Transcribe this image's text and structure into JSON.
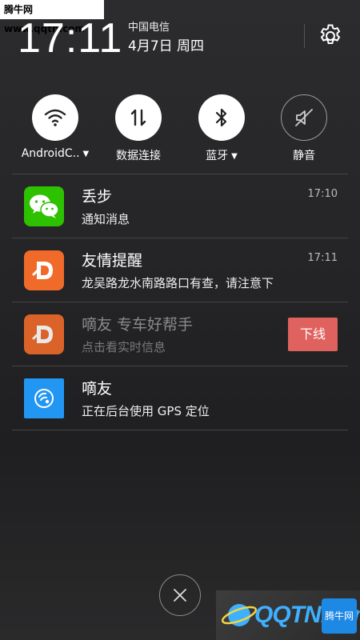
{
  "watermark": "腾牛网 www.qqtn.com",
  "status": {
    "time": "17:11",
    "carrier": "中国电信",
    "date": "4月7日 周四"
  },
  "toggles": [
    {
      "label": "AndroidC..",
      "icon": "wifi-icon",
      "state": "on",
      "dropdown": true
    },
    {
      "label": "数据连接",
      "icon": "data-transfer-icon",
      "state": "on",
      "dropdown": false
    },
    {
      "label": "蓝牙",
      "icon": "bluetooth-icon",
      "state": "on",
      "dropdown": true
    },
    {
      "label": "静音",
      "icon": "mute-icon",
      "state": "off",
      "dropdown": false
    }
  ],
  "notifications": [
    {
      "app_icon": "wechat-icon",
      "title": "丢步",
      "body": "通知消息",
      "time": "17:10"
    },
    {
      "app_icon": "didi-icon",
      "title": "友情提醒",
      "body": "龙吴路龙水南路路口有查，请注意下",
      "time": "17:11"
    },
    {
      "app_icon": "didi-icon",
      "title": "嘀友 专车好帮手",
      "body": "点击看实时信息",
      "action": "下线"
    },
    {
      "app_icon": "location-icon",
      "title": "嘀友",
      "body": "正在后台使用 GPS 定位"
    }
  ],
  "footer": {
    "logo_text": "QQTN.com",
    "badge_text": "腾牛网"
  },
  "colors": {
    "wechat": "#2dc100",
    "didi": "#f06a2a",
    "location": "#2196f3",
    "offline": "#e0625e"
  }
}
